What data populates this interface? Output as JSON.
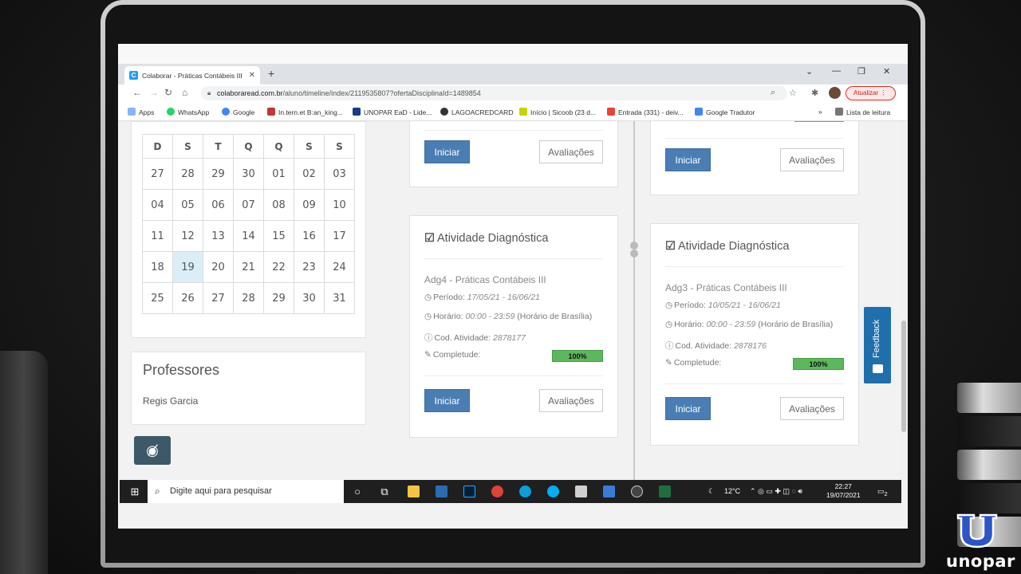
{
  "browser": {
    "tab_title": "Colaborar - Práticas Contábeis III",
    "tab_favicon": "C",
    "url_host": "colaboraread.com.br",
    "url_path": "/aluno/timeline/index/2119535807?ofertaDisciplinaId=1489854",
    "update_label": "Atualizar",
    "reading_list_label": "Lista de leitura",
    "bookmarks": [
      "Apps",
      "WhatsApp",
      "Google",
      "In.tern.et B:an_king...",
      "UNOPAR EaD - Lide...",
      "LAGOACREDCARD",
      "Início | Sicoob (23 d...",
      "Entrada (331) - deiv...",
      "Google Tradutor"
    ]
  },
  "calendar": {
    "weekdays": [
      "D",
      "S",
      "T",
      "Q",
      "Q",
      "S",
      "S"
    ],
    "weeks": [
      [
        "27",
        "28",
        "29",
        "30",
        "01",
        "02",
        "03"
      ],
      [
        "04",
        "05",
        "06",
        "07",
        "08",
        "09",
        "10"
      ],
      [
        "11",
        "12",
        "13",
        "14",
        "15",
        "16",
        "17"
      ],
      [
        "18",
        "19",
        "20",
        "21",
        "22",
        "23",
        "24"
      ],
      [
        "25",
        "26",
        "27",
        "28",
        "29",
        "30",
        "31"
      ]
    ],
    "today": "19"
  },
  "professors": {
    "title": "Professores",
    "name": "Regis Garcia"
  },
  "cards": [
    {
      "title": "Atividade Diagnóstica",
      "subtitle": "Adg4 - Práticas Contábeis III",
      "periodo_label": "Período:",
      "periodo_value": "17/05/21 - 16/06/21",
      "horario_label": "Horário:",
      "horario_value": "00:00 - 23:59",
      "horario_suffix": "(Horário de Brasília)",
      "codigo_label": "Cod. Atividade:",
      "codigo_value": "2878177",
      "completude_label": "Completude:",
      "completude_value": "100%",
      "start_label": "Iniciar",
      "reviews_label": "Avaliações"
    },
    {
      "title": "Atividade Diagnóstica",
      "subtitle": "Adg3 - Práticas Contábeis III",
      "periodo_label": "Período:",
      "periodo_value": "10/05/21 - 16/06/21",
      "horario_label": "Horário:",
      "horario_value": "00:00 - 23:59",
      "horario_suffix": "(Horário de Brasília)",
      "codigo_label": "Cod. Atividade:",
      "codigo_value": "2878176",
      "completude_label": "Completude:",
      "completude_value": "100%",
      "start_label": "Iniciar",
      "reviews_label": "Avaliações"
    }
  ],
  "top_cards": {
    "start_label": "Iniciar",
    "reviews_label": "Avaliações"
  },
  "feedback_label": "Feedback",
  "taskbar": {
    "search_placeholder": "Digite aqui para pesquisar",
    "weather": "12°C",
    "time": "22:27",
    "date": "19/07/2021",
    "notifications": "2"
  },
  "brand": {
    "name": "unopar"
  },
  "colors": {
    "primary_button": "#4a7db3",
    "progress": "#5cb85c",
    "feedback": "#1f6fad"
  }
}
